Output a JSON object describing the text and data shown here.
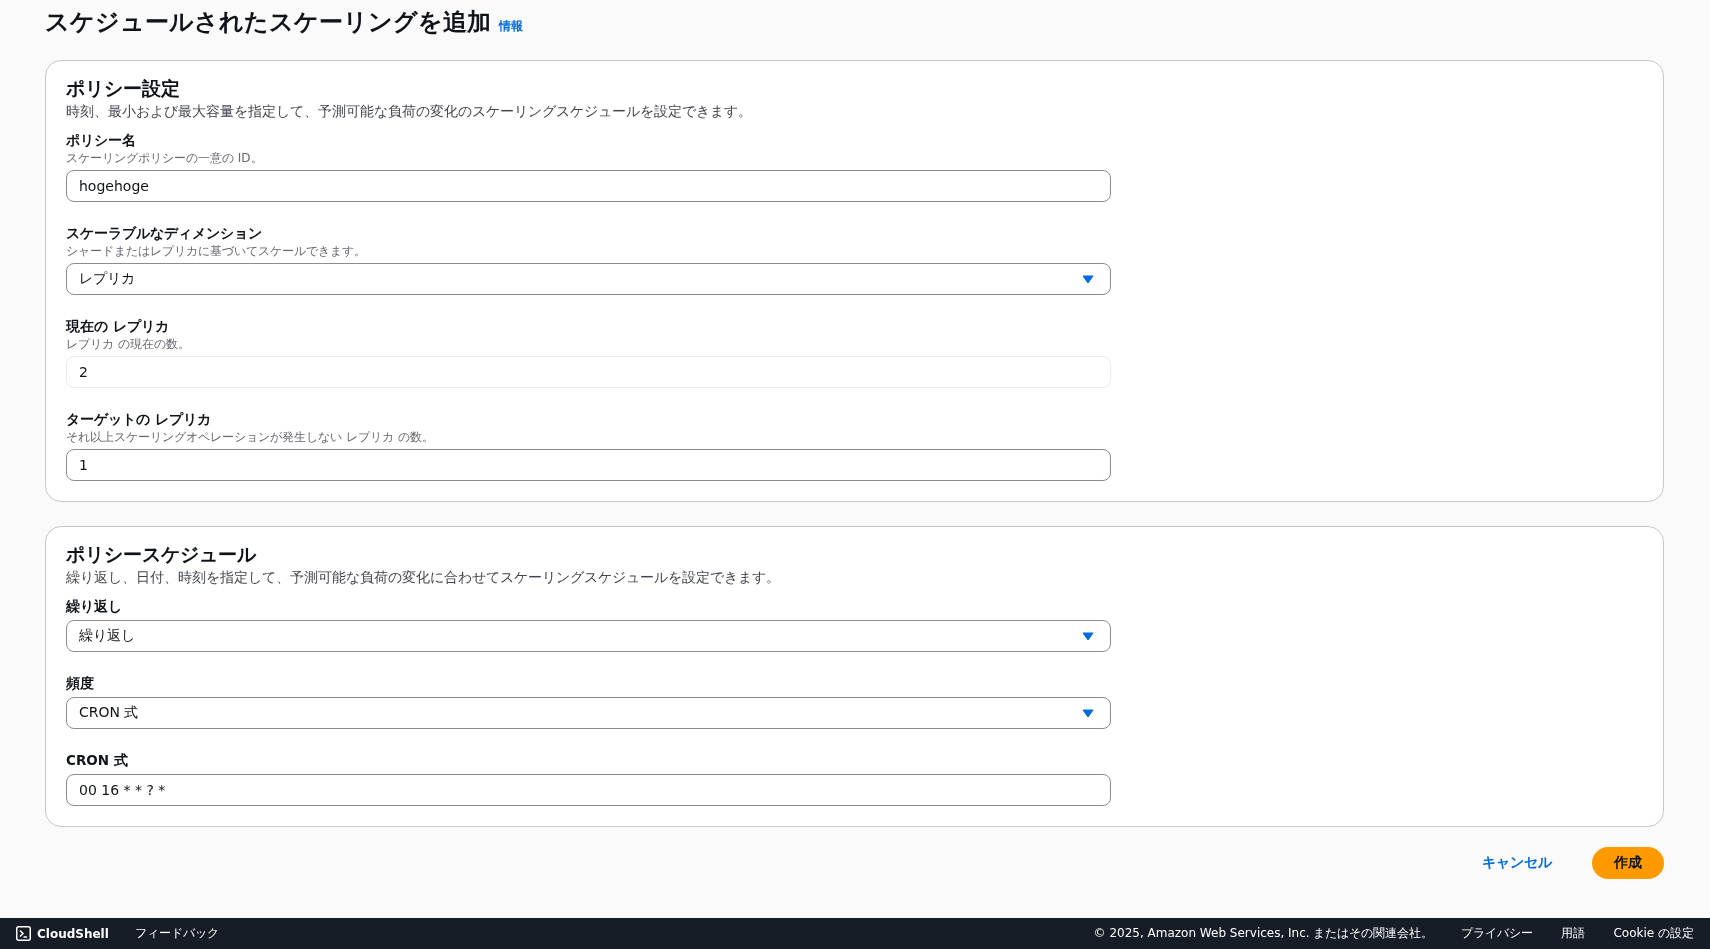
{
  "page": {
    "title": "スケジュールされたスケーリングを追加",
    "info_link": "情報"
  },
  "sections": [
    {
      "title": "ポリシー設定",
      "description": "時刻、最小および最大容量を指定して、予測可能な負荷の変化のスケーリングスケジュールを設定できます。",
      "fields": [
        {
          "kind": "text",
          "label": "ポリシー名",
          "hint": "スケーリングポリシーの一意の ID。",
          "value": "hogehoge",
          "disabled": false
        },
        {
          "kind": "select",
          "label": "スケーラブルなディメンション",
          "hint": "シャードまたはレプリカに基づいてスケールできます。",
          "value": "レプリカ",
          "disabled": false
        },
        {
          "kind": "text",
          "label": "現在の レプリカ",
          "hint": "レプリカ の現在の数。",
          "value": "2",
          "disabled": true
        },
        {
          "kind": "text",
          "label": "ターゲットの レプリカ",
          "hint": "それ以上スケーリングオペレーションが発生しない レプリカ の数。",
          "value": "1",
          "disabled": false
        }
      ]
    },
    {
      "title": "ポリシースケジュール",
      "description": "繰り返し、日付、時刻を指定して、予測可能な負荷の変化に合わせてスケーリングスケジュールを設定できます。",
      "fields": [
        {
          "kind": "select",
          "label": "繰り返し",
          "value": "繰り返し",
          "disabled": false
        },
        {
          "kind": "select",
          "label": "頻度",
          "value": "CRON 式",
          "disabled": false
        },
        {
          "kind": "text",
          "label": "CRON 式",
          "value": "00 16 * * ? *",
          "disabled": false
        }
      ]
    }
  ],
  "actions": {
    "cancel": "キャンセル",
    "submit": "作成"
  },
  "footer": {
    "cloudshell": "CloudShell",
    "feedback": "フィードバック",
    "copyright": "© 2025, Amazon Web Services, Inc. またはその関連会社。",
    "links": [
      "プライバシー",
      "用語",
      "Cookie の設定"
    ]
  }
}
